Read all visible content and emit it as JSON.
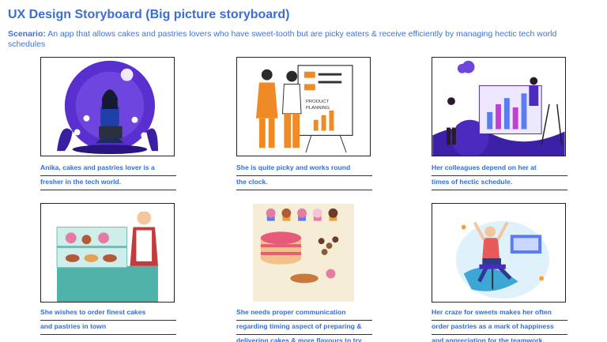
{
  "title": "UX Design Storyboard (Big picture storyboard)",
  "scenario": {
    "label": "Scenario:",
    "text": " An app that allows cakes and pastries lovers who have sweet-tooth but are picky eaters  & receive efficiently by managing hectic tech world schedules"
  },
  "panels": [
    {
      "illustration": "woman-with-laptop",
      "caption": [
        "Anika, cakes and pastries lover is a",
        "fresher in the tech world."
      ]
    },
    {
      "illustration": "product-planning-board",
      "caption": [
        "She is quite picky and works round",
        "the clock."
      ]
    },
    {
      "illustration": "colleagues-at-dashboard",
      "caption": [
        "Her colleagues depend on her at",
        "times of hectic schedule."
      ]
    },
    {
      "illustration": "pastry-shop-counter",
      "caption": [
        "She wishes to order finest cakes",
        "and pastries in town"
      ]
    },
    {
      "illustration": "cakes-and-cupcakes",
      "caption": [
        "She needs proper communication",
        "regarding timing aspect of preparing &",
        "delivering cakes & more flavours to try"
      ]
    },
    {
      "illustration": "excited-person-on-chair",
      "caption": [
        "Her craze for sweets makes her often",
        "order pastries as a mark of happiness",
        "and appreciation for the teamwork."
      ]
    }
  ],
  "colors": {
    "accent": "#3a6ed6",
    "purple": "#4b2bbf",
    "orange": "#f08a24"
  }
}
